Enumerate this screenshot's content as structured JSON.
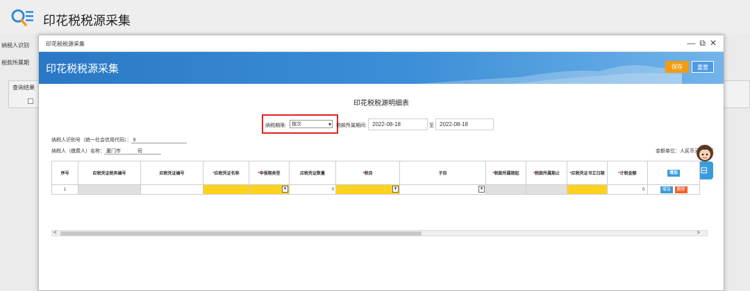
{
  "page": {
    "title": "印花税税源采集",
    "labels": [
      "纳税人识别",
      "税款所属期",
      "查询结果"
    ]
  },
  "modal": {
    "title": "印花税税源采集",
    "controls": {
      "minimize": "—",
      "restore": "⧉",
      "close": "✕"
    },
    "banner_title": "印花税税源采集",
    "save_label": "保存",
    "reset_label": "重置"
  },
  "form": {
    "title": "印花税税源明细表",
    "period_label": "纳税期限:",
    "period_value": "按次",
    "date_label": "税款所属期间:",
    "date_from": "2022-08-18",
    "date_to_sep": "至",
    "date_to": "2022-08-18",
    "taxpayer_id_label": "纳税人识别号（统一社会信用代码）：",
    "taxpayer_id_value": "9",
    "taxpayer_name_label": "纳税人（缴费人）名称：",
    "taxpayer_name_value": "厦门市",
    "taxpayer_name_suffix": "司",
    "unit_label": "金额单位：人民币元（列至"
  },
  "table": {
    "headers": [
      {
        "label": "序号",
        "required": false
      },
      {
        "label": "应税凭证税务编号",
        "required": false
      },
      {
        "label": "应税凭证编号",
        "required": false
      },
      {
        "label": "应税凭证名称",
        "required": true
      },
      {
        "label": "申报期类型",
        "required": true
      },
      {
        "label": "应税凭证数量",
        "required": false
      },
      {
        "label": "税目",
        "required": true
      },
      {
        "label": "子目",
        "required": false
      },
      {
        "label": "税款所属期起",
        "required": true
      },
      {
        "label": "税款所属期止",
        "required": true
      },
      {
        "label": "应税凭证书立日期",
        "required": true
      },
      {
        "label": "计税金额",
        "required": true
      },
      {
        "label": "增加",
        "required": false
      }
    ],
    "rows": [
      {
        "index": "1",
        "quantity": "0",
        "amount": "0.",
        "add_label": "增加",
        "delete_label": "删除"
      }
    ]
  },
  "scroll": {
    "left": "<",
    "right": ">"
  },
  "side": {
    "icon_char": "⊟"
  },
  "colors": {
    "banner": "#2a78c5",
    "required_cell": "#ffd21f",
    "save": "#f39c12",
    "highlight": "#e02020"
  }
}
